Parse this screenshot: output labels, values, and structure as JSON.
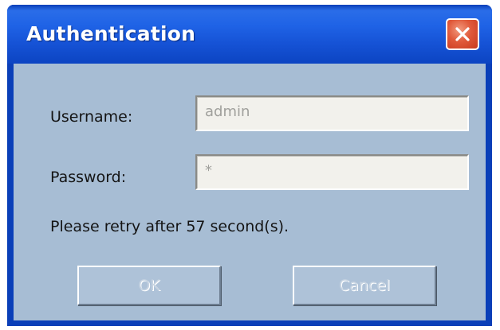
{
  "window": {
    "title": "Authentication",
    "close_icon": "close-x-icon"
  },
  "form": {
    "username_label": "Username:",
    "username_value": "admin",
    "password_label": "Password:",
    "password_value": "*",
    "retry_message": "Please retry after 57 second(s)."
  },
  "buttons": {
    "ok_label": "OK",
    "cancel_label": "Cancel",
    "enabled": false
  },
  "colors": {
    "titlebar": "#1f63e6",
    "client_bg": "#a7bdd4",
    "close_button": "#e0593a"
  }
}
